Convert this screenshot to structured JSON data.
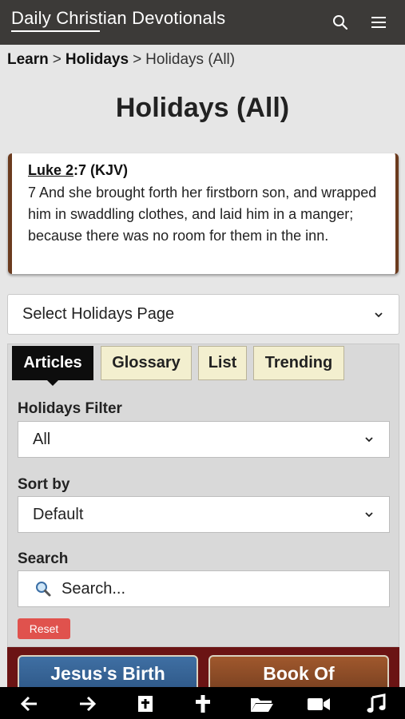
{
  "header": {
    "title": "Daily Christian Devotionals",
    "icons": [
      "search-icon",
      "hamburger-menu-icon"
    ]
  },
  "breadcrumb": {
    "items": [
      "Learn",
      "Holidays"
    ],
    "separator": ">",
    "current": "Holidays (All)"
  },
  "page": {
    "title": "Holidays (All)"
  },
  "verse": {
    "book": "Luke 2",
    "ref_rest": ":7 (KJV)",
    "text": "7 And she brought forth her firstborn son, and wrapped him in swaddling clothes, and laid him in a manger; because there was no room for them in the inn."
  },
  "page_select": {
    "value": "Select Holidays Page"
  },
  "tabs": [
    {
      "label": "Articles",
      "active": true
    },
    {
      "label": "Glossary",
      "active": false
    },
    {
      "label": "List",
      "active": false
    },
    {
      "label": "Trending",
      "active": false
    }
  ],
  "filters": {
    "holidays_filter_label": "Holidays Filter",
    "holidays_filter_value": "All",
    "sort_label": "Sort by",
    "sort_value": "Default",
    "search_label": "Search",
    "search_placeholder": "Search...",
    "reset_label": "Reset"
  },
  "cards": [
    {
      "title": "Jesus's Birth"
    },
    {
      "title": "Book Of"
    }
  ],
  "bottom_nav": {
    "icons": [
      "back-arrow-icon",
      "forward-arrow-icon",
      "bible-icon",
      "cross-icon",
      "folder-icon",
      "video-icon",
      "music-icon"
    ]
  },
  "colors": {
    "header_bg": "#3c3a38",
    "verse_border": "#6b3b1e",
    "tab_active_bg": "#0d0d0d",
    "tab_bg": "#f3efcf",
    "reset_bg": "#e0524d",
    "cards_strip_bg": "#6b1414"
  }
}
